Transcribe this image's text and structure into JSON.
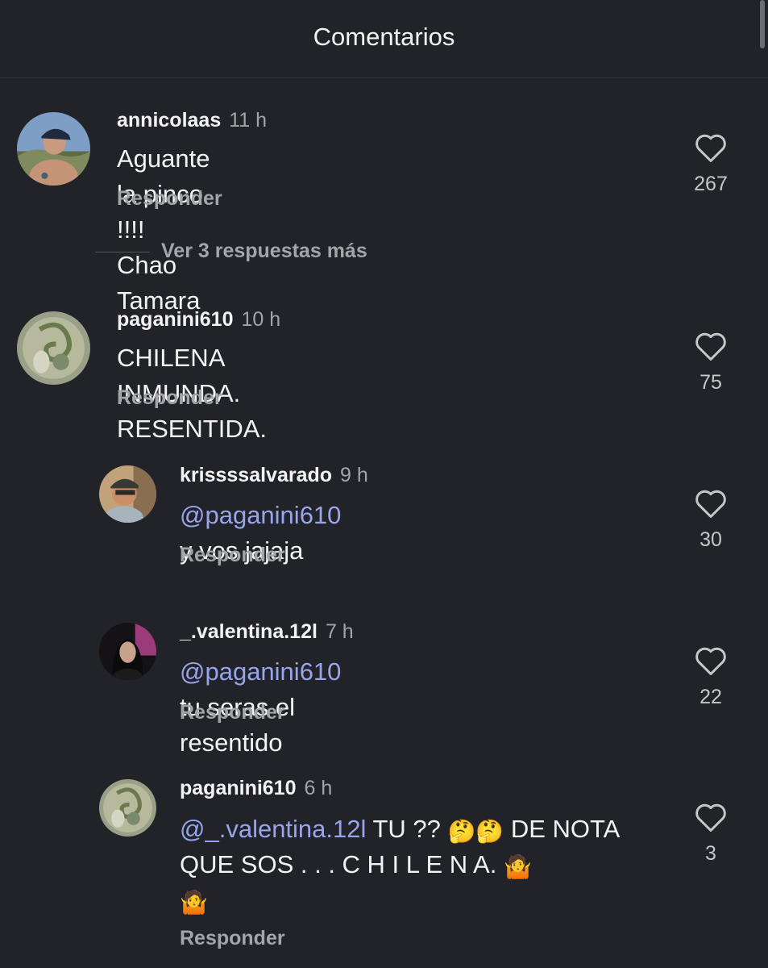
{
  "header": {
    "title": "Comentarios"
  },
  "more_replies": {
    "label": "Ver 3 respuestas más"
  },
  "comments": [
    {
      "username": "annicolaas",
      "time": "11 h",
      "text": "Aguante la pinco !!!! Chao Tamara",
      "reply_label": "Responder",
      "likes": "267"
    },
    {
      "username": "paganini610",
      "time": "10 h",
      "text": "CHILENA INMUNDA. RESENTIDA.",
      "reply_label": "Responder",
      "likes": "75"
    },
    {
      "username": "krissssalvarado",
      "time": "9 h",
      "mention": "@paganini610",
      "text": " y vos jajaja",
      "reply_label": "Responder",
      "likes": "30"
    },
    {
      "username": "_.valentina.12l",
      "time": "7 h",
      "mention": "@paganini610",
      "text": " tu seras el resentido",
      "reply_label": "Responder",
      "likes": "22"
    },
    {
      "username": "paganini610",
      "time": "6 h",
      "mention": "@_.valentina.12l",
      "text_1": " TU ?? ",
      "emoji_thinking": "🤔🤔",
      "text_2": " DE NOTA QUE SOS . . . C H I L E N A. ",
      "emoji_shrug_1": "🤷",
      "emoji_shrug_2": "🤷",
      "reply_label": "Responder",
      "likes": "3"
    }
  ],
  "colors": {
    "background": "#212328",
    "text": "#f3f3f3",
    "muted": "#a3a5aa",
    "mention": "#98a4ee"
  },
  "icons": {
    "like": "heart-outline-icon"
  }
}
